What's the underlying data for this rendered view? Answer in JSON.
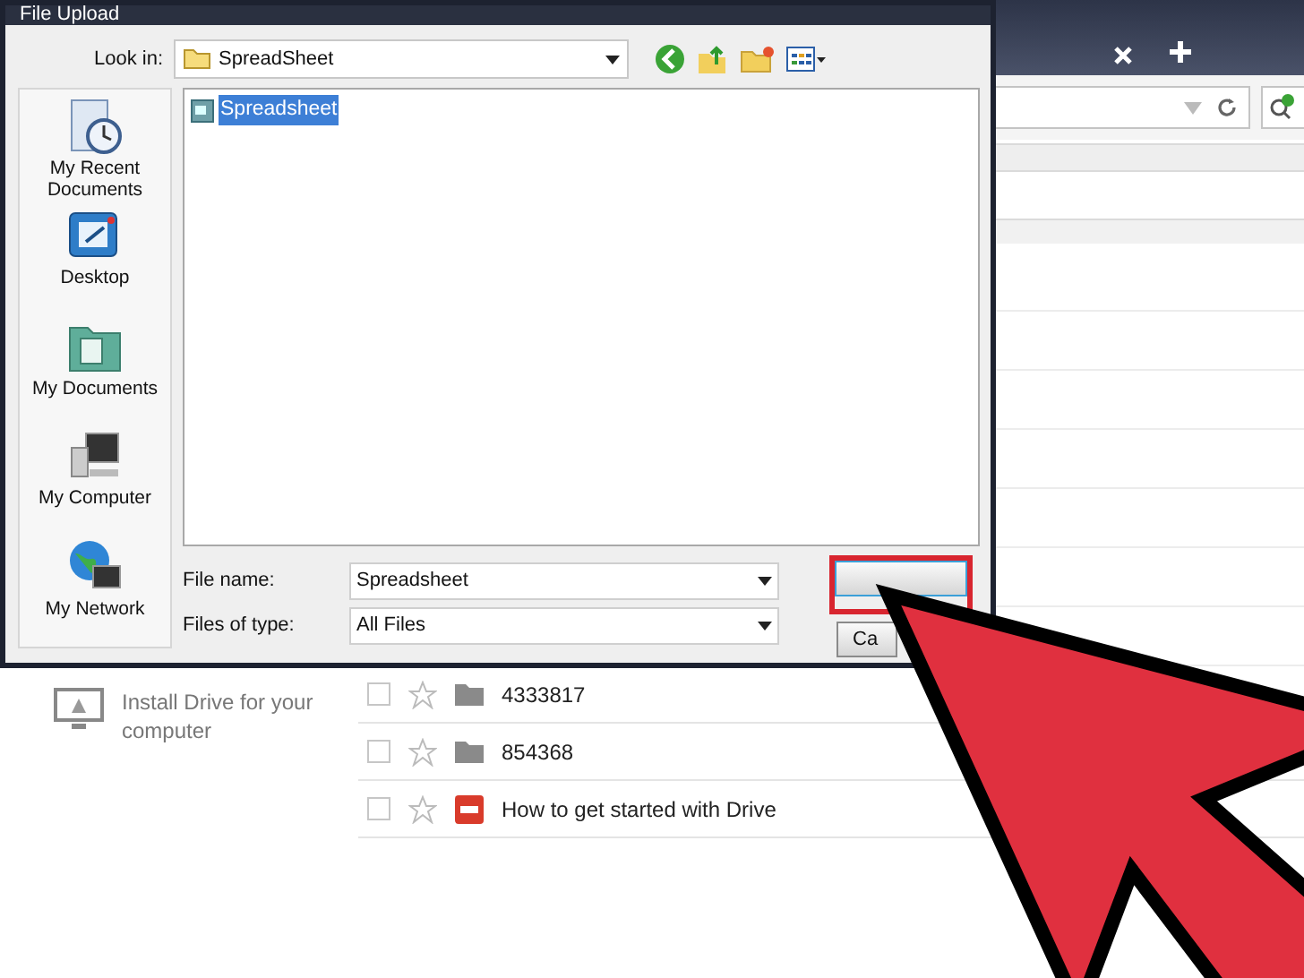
{
  "dialog": {
    "title": "File Upload",
    "look_in": {
      "label": "Look in:",
      "value": "SpreadSheet"
    },
    "places": [
      {
        "label": "My Recent Documents",
        "kind": "recent"
      },
      {
        "label": "Desktop",
        "kind": "desktop"
      },
      {
        "label": "My Documents",
        "kind": "documents"
      },
      {
        "label": "My Computer",
        "kind": "computer"
      },
      {
        "label": "My Network",
        "kind": "network"
      }
    ],
    "files": [
      {
        "name": "Spreadsheet",
        "selected": true
      }
    ],
    "file_name": {
      "label": "File name:",
      "value": "Spreadsheet"
    },
    "file_type": {
      "label": "Files of type:",
      "value": "All Files"
    },
    "buttons": [
      {
        "kind": "open",
        "highlighted": true
      },
      {
        "kind": "cancel",
        "label": "Ca",
        "highlighted": false
      }
    ]
  },
  "drive": {
    "install": "Install Drive for your computer",
    "files": [
      {
        "name": "4333817",
        "kind": "folder",
        "checked": false,
        "starred": false
      },
      {
        "name": "854368",
        "kind": "folder",
        "checked": false,
        "starred": false
      },
      {
        "name": "How to get started with Drive",
        "kind": "pdf",
        "checked": false,
        "starred": false
      }
    ]
  }
}
